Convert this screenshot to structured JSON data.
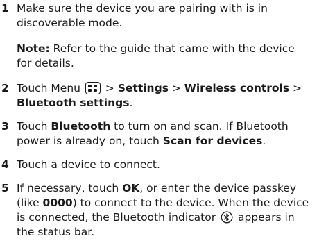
{
  "steps": [
    {
      "num": "1",
      "line1": "Make sure the device you are pairing with is in",
      "line2": "discoverable mode."
    },
    {
      "note_label": "Note:",
      "note_text1": " Refer to the guide that came with the device",
      "note_text2": "for details."
    },
    {
      "num": "2",
      "t1": "Touch Menu ",
      "t2": " > ",
      "settings": "Settings",
      "t3": " > ",
      "wireless": "Wireless controls",
      "t4": " >",
      "bt_settings": "Bluetooth settings",
      "t5": "."
    },
    {
      "num": "3",
      "t1": "Touch ",
      "bluetooth": "Bluetooth",
      "t2": " to turn on and scan. If Bluetooth",
      "t3": "power is already on, touch ",
      "scan": "Scan for devices",
      "t4": "."
    },
    {
      "num": "4",
      "line1": "Touch a device to connect."
    },
    {
      "num": "5",
      "t1": "If necessary, touch ",
      "ok": "OK",
      "t2": ", or enter the device passkey",
      "t3": "(like ",
      "code": "0000",
      "t4": ") to connect to the device. When the device",
      "t5": "is connected, the Bluetooth indicator ",
      "t6": " appears in",
      "t7": "the status bar."
    }
  ],
  "icons": {
    "menu": "menu-key-icon",
    "bluetooth": "bluetooth-indicator-icon"
  }
}
